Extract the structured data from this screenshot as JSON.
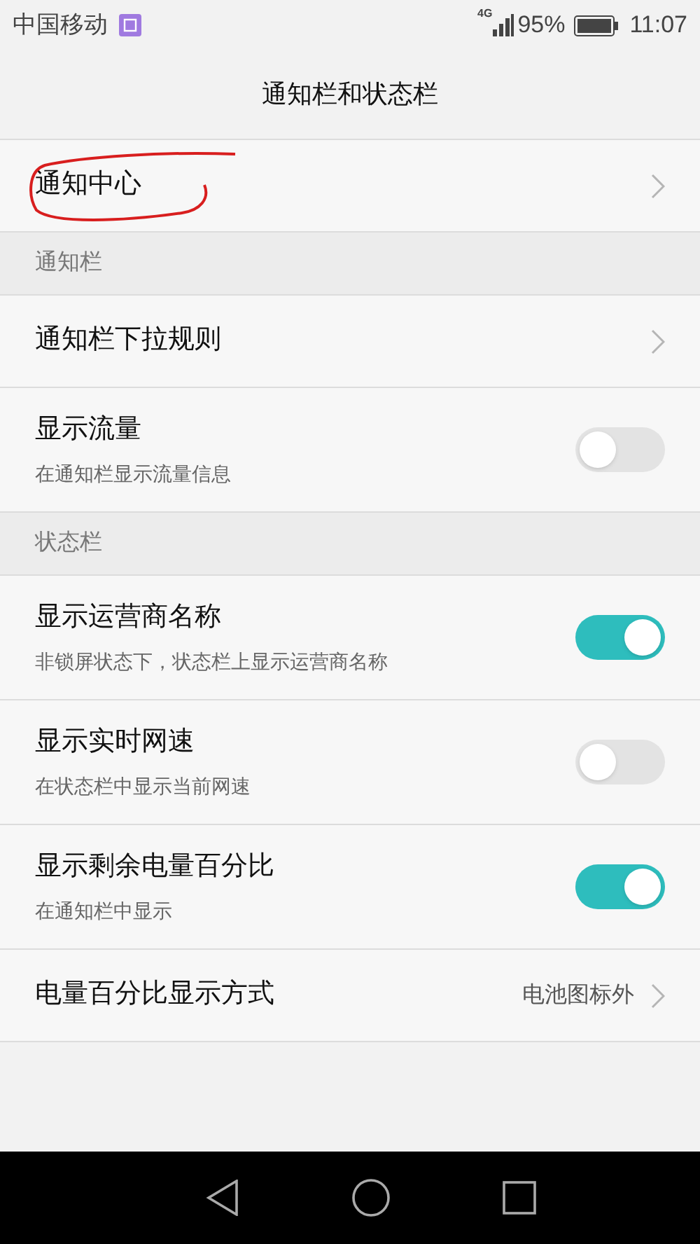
{
  "status_bar": {
    "carrier": "中国移动",
    "network": "4G",
    "battery": "95%",
    "time": "11:07"
  },
  "title": "通知栏和状态栏",
  "items": [
    {
      "kind": "link",
      "title": "通知中心",
      "annotated": true
    },
    {
      "kind": "header",
      "title": "通知栏"
    },
    {
      "kind": "link",
      "title": "通知栏下拉规则"
    },
    {
      "kind": "toggle",
      "title": "显示流量",
      "subtitle": "在通知栏显示流量信息",
      "on": false
    },
    {
      "kind": "header",
      "title": "状态栏"
    },
    {
      "kind": "toggle",
      "title": "显示运营商名称",
      "subtitle": "非锁屏状态下，状态栏上显示运营商名称",
      "on": true
    },
    {
      "kind": "toggle",
      "title": "显示实时网速",
      "subtitle": "在状态栏中显示当前网速",
      "on": false
    },
    {
      "kind": "toggle",
      "title": "显示剩余电量百分比",
      "subtitle": "在通知栏中显示",
      "on": true
    },
    {
      "kind": "link",
      "title": "电量百分比显示方式",
      "value": "电池图标外"
    }
  ]
}
